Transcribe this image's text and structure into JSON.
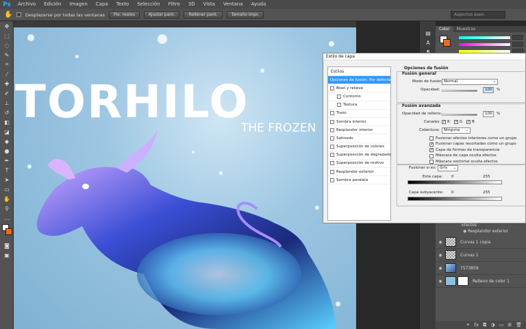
{
  "app": {
    "logo": "Ps"
  },
  "menu": [
    "Archivo",
    "Edición",
    "Imagen",
    "Capa",
    "Texto",
    "Selección",
    "Filtro",
    "3D",
    "Vista",
    "Ventana",
    "Ayuda"
  ],
  "options": {
    "scroll_all_label": "Desplazarse por todas las ventanas",
    "buttons": [
      "Píx. reales",
      "Ajustar pant.",
      "Rellenar pant.",
      "Tamaño impr."
    ],
    "workspace": "Aspectos esen."
  },
  "canvas": {
    "title": "TORHILO",
    "subtitle": "THE FROZEN"
  },
  "color_panel": {
    "tabs": [
      "Color",
      "Muestras"
    ],
    "fg_color": "#ffffff",
    "bg_color": "#f26a1b"
  },
  "dialog": {
    "title": "Estilo de capa",
    "list_header": "Estilos",
    "items": [
      {
        "label": "Opciones de fusión: Por defecto",
        "selected": true,
        "checkbox": false,
        "sub": false
      },
      {
        "label": "Bisel y relieve",
        "selected": false,
        "checkbox": true,
        "sub": false
      },
      {
        "label": "Contorno",
        "selected": false,
        "checkbox": true,
        "sub": true
      },
      {
        "label": "Textura",
        "selected": false,
        "checkbox": true,
        "sub": true
      },
      {
        "label": "Trazo",
        "selected": false,
        "checkbox": true,
        "sub": false
      },
      {
        "label": "Sombra interior",
        "selected": false,
        "checkbox": true,
        "sub": false
      },
      {
        "label": "Resplandor interior",
        "selected": false,
        "checkbox": true,
        "sub": false
      },
      {
        "label": "Satinado",
        "selected": false,
        "checkbox": true,
        "sub": false
      },
      {
        "label": "Superposición de colores",
        "selected": false,
        "checkbox": true,
        "sub": false
      },
      {
        "label": "Superposición de degradado",
        "selected": false,
        "checkbox": true,
        "sub": false
      },
      {
        "label": "Superposición de motivo",
        "selected": false,
        "checkbox": true,
        "sub": false
      },
      {
        "label": "Resplandor exterior",
        "selected": false,
        "checkbox": true,
        "sub": false
      },
      {
        "label": "Sombra paralela",
        "selected": false,
        "checkbox": true,
        "sub": false
      }
    ],
    "blend_title": "Opciones de fusión",
    "general": {
      "title": "Fusión general",
      "mode_label": "Modo de fusión:",
      "mode_value": "Normal",
      "opacity_label": "Opacidad:",
      "opacity_value": "100",
      "percent": "%"
    },
    "advanced": {
      "title": "Fusión avanzada",
      "fill_label": "Opacidad de relleno:",
      "fill_value": "100",
      "percent": "%",
      "channels_label": "Canales:",
      "ch_r": "R",
      "ch_g": "G",
      "ch_b": "B",
      "knockout_label": "Cobertura:",
      "knockout_value": "Ninguna",
      "checks": [
        {
          "label": "Fusionar efectos interiores como un grupo",
          "checked": false
        },
        {
          "label": "Fusionar capas recortadas como un grupo",
          "checked": true
        },
        {
          "label": "Capa de formas de transparencia",
          "checked": true
        },
        {
          "label": "Máscara de capa oculta efectos",
          "checked": false
        },
        {
          "label": "Máscara vectorial oculta efectos",
          "checked": false
        }
      ]
    },
    "blendif": {
      "label": "Fusionar si es:",
      "value": "Gris",
      "this_layer": "Esta capa:",
      "this_min": "0",
      "this_max": "255",
      "under_layer": "Capa subyacente:",
      "under_min": "0",
      "under_max": "255"
    }
  },
  "layers": {
    "effects_label": "Efectos",
    "effect_item": "Resplandor exterior",
    "rows": [
      "Curvas 1 copia",
      "Curvas 1",
      "7573859",
      "Relleno de color 1"
    ]
  }
}
